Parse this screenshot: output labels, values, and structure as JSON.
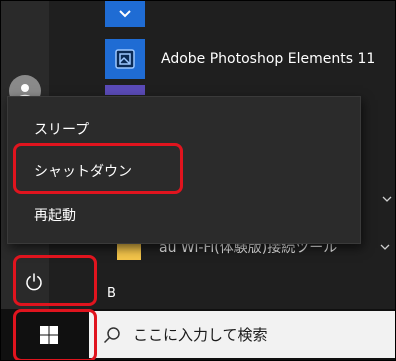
{
  "start_menu": {
    "app_item": {
      "label": "Adobe Photoshop Elements 11",
      "icon": "photoshop-elements-icon"
    },
    "folder_item": {
      "label": "au Wi-Fi(体験版)接続ツール",
      "icon": "folder-icon"
    },
    "section_letter": "B"
  },
  "power_menu": {
    "items": [
      {
        "label": "スリープ"
      },
      {
        "label": "シャットダウン"
      },
      {
        "label": "再起動"
      }
    ]
  },
  "taskbar": {
    "search_placeholder": "ここに入力して検索",
    "start_icon": "windows-logo-icon",
    "search_icon": "search-icon"
  },
  "colors": {
    "highlight": "#e0141e",
    "tile_blue": "#1f6cd4",
    "menu_bg": "#2b2b2b"
  }
}
